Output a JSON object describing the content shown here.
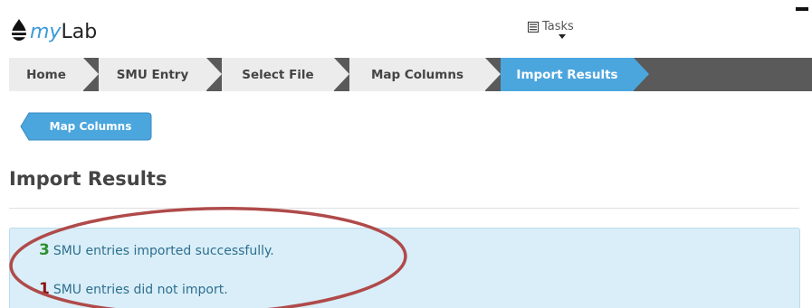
{
  "app": {
    "logo_prefix": "my",
    "logo_suffix": "Lab",
    "tasks_label": "Tasks"
  },
  "breadcrumbs": [
    {
      "label": "Home"
    },
    {
      "label": "SMU Entry"
    },
    {
      "label": "Select File"
    },
    {
      "label": "Map Columns"
    },
    {
      "label": "Import Results",
      "active": true
    }
  ],
  "back_button": {
    "label": "Map Columns"
  },
  "page": {
    "title": "Import Results"
  },
  "results": {
    "success": {
      "count": "3",
      "text": "SMU entries imported successfully."
    },
    "failure": {
      "count": "1",
      "text": "SMU entries did not import."
    }
  },
  "colors": {
    "accent": "#4ba6de",
    "panel": "#d9eef8",
    "success": "#2f8f2f",
    "failure": "#8a1414",
    "annotation": "#b04a4a"
  },
  "icons": {
    "logo": "drop-icon",
    "tasks": "list-icon",
    "tasks_menu": "chevron-down-icon"
  }
}
